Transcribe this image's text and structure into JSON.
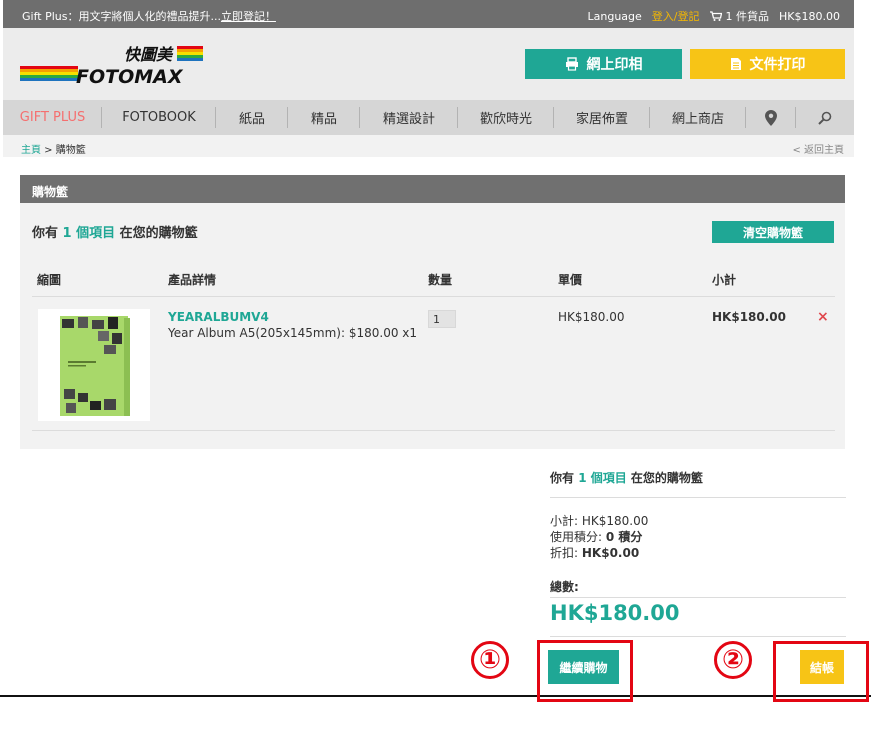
{
  "topbar": {
    "promo_prefix": "Gift Plus：用文字將個人化的禮品提升...",
    "promo_link": "立即登記！",
    "language": "Language",
    "login": "登入/登記",
    "cart_items": "1 件貨品",
    "cart_total": "HK$180.00"
  },
  "header": {
    "logo_cn": "快圖美",
    "logo_en": "FOTOMAX",
    "btn_print": "網上印相",
    "btn_doc": "文件打印"
  },
  "nav": {
    "items": [
      "GIFT PLUS",
      "FOTOBOOK",
      "紙品",
      "精品",
      "精選設計",
      "歡欣時光",
      "家居佈置",
      "網上商店"
    ]
  },
  "breadcrumb": {
    "home": "主頁",
    "sep": " > ",
    "current": "購物籃",
    "back": "< 返回主頁"
  },
  "cart": {
    "title": "購物籃",
    "count_prefix": "你有",
    "count": "1 個項目",
    "count_suffix": "在您的購物籃",
    "clear_label": "清空購物籃",
    "columns": [
      "縮圖",
      "產品詳情",
      "數量",
      "單價",
      "小計"
    ],
    "item": {
      "name": "YEARALBUMV4",
      "desc": "Year Album A5(205x145mm): $180.00 x1",
      "qty": "1",
      "unit_price": "HK$180.00",
      "subtotal": "HK$180.00",
      "remove": "×"
    }
  },
  "summary": {
    "count_prefix": "你有",
    "count": "1 個項目",
    "count_suffix": "在您的購物籃",
    "subtotal_label": "小計:",
    "subtotal": "HK$180.00",
    "points_label": "使用積分:",
    "points": "0 積分",
    "discount_label": "折扣:",
    "discount": "HK$0.00",
    "total_label": "總數:",
    "total": "HK$180.00",
    "continue_label": "繼續購物",
    "checkout_label": "結帳"
  },
  "annotations": [
    "①",
    "②"
  ],
  "colors": {
    "teal": "#1fa795",
    "yellow": "#f7c416",
    "annotation_red": "#e30613",
    "nav_active": "#f56f6f"
  }
}
